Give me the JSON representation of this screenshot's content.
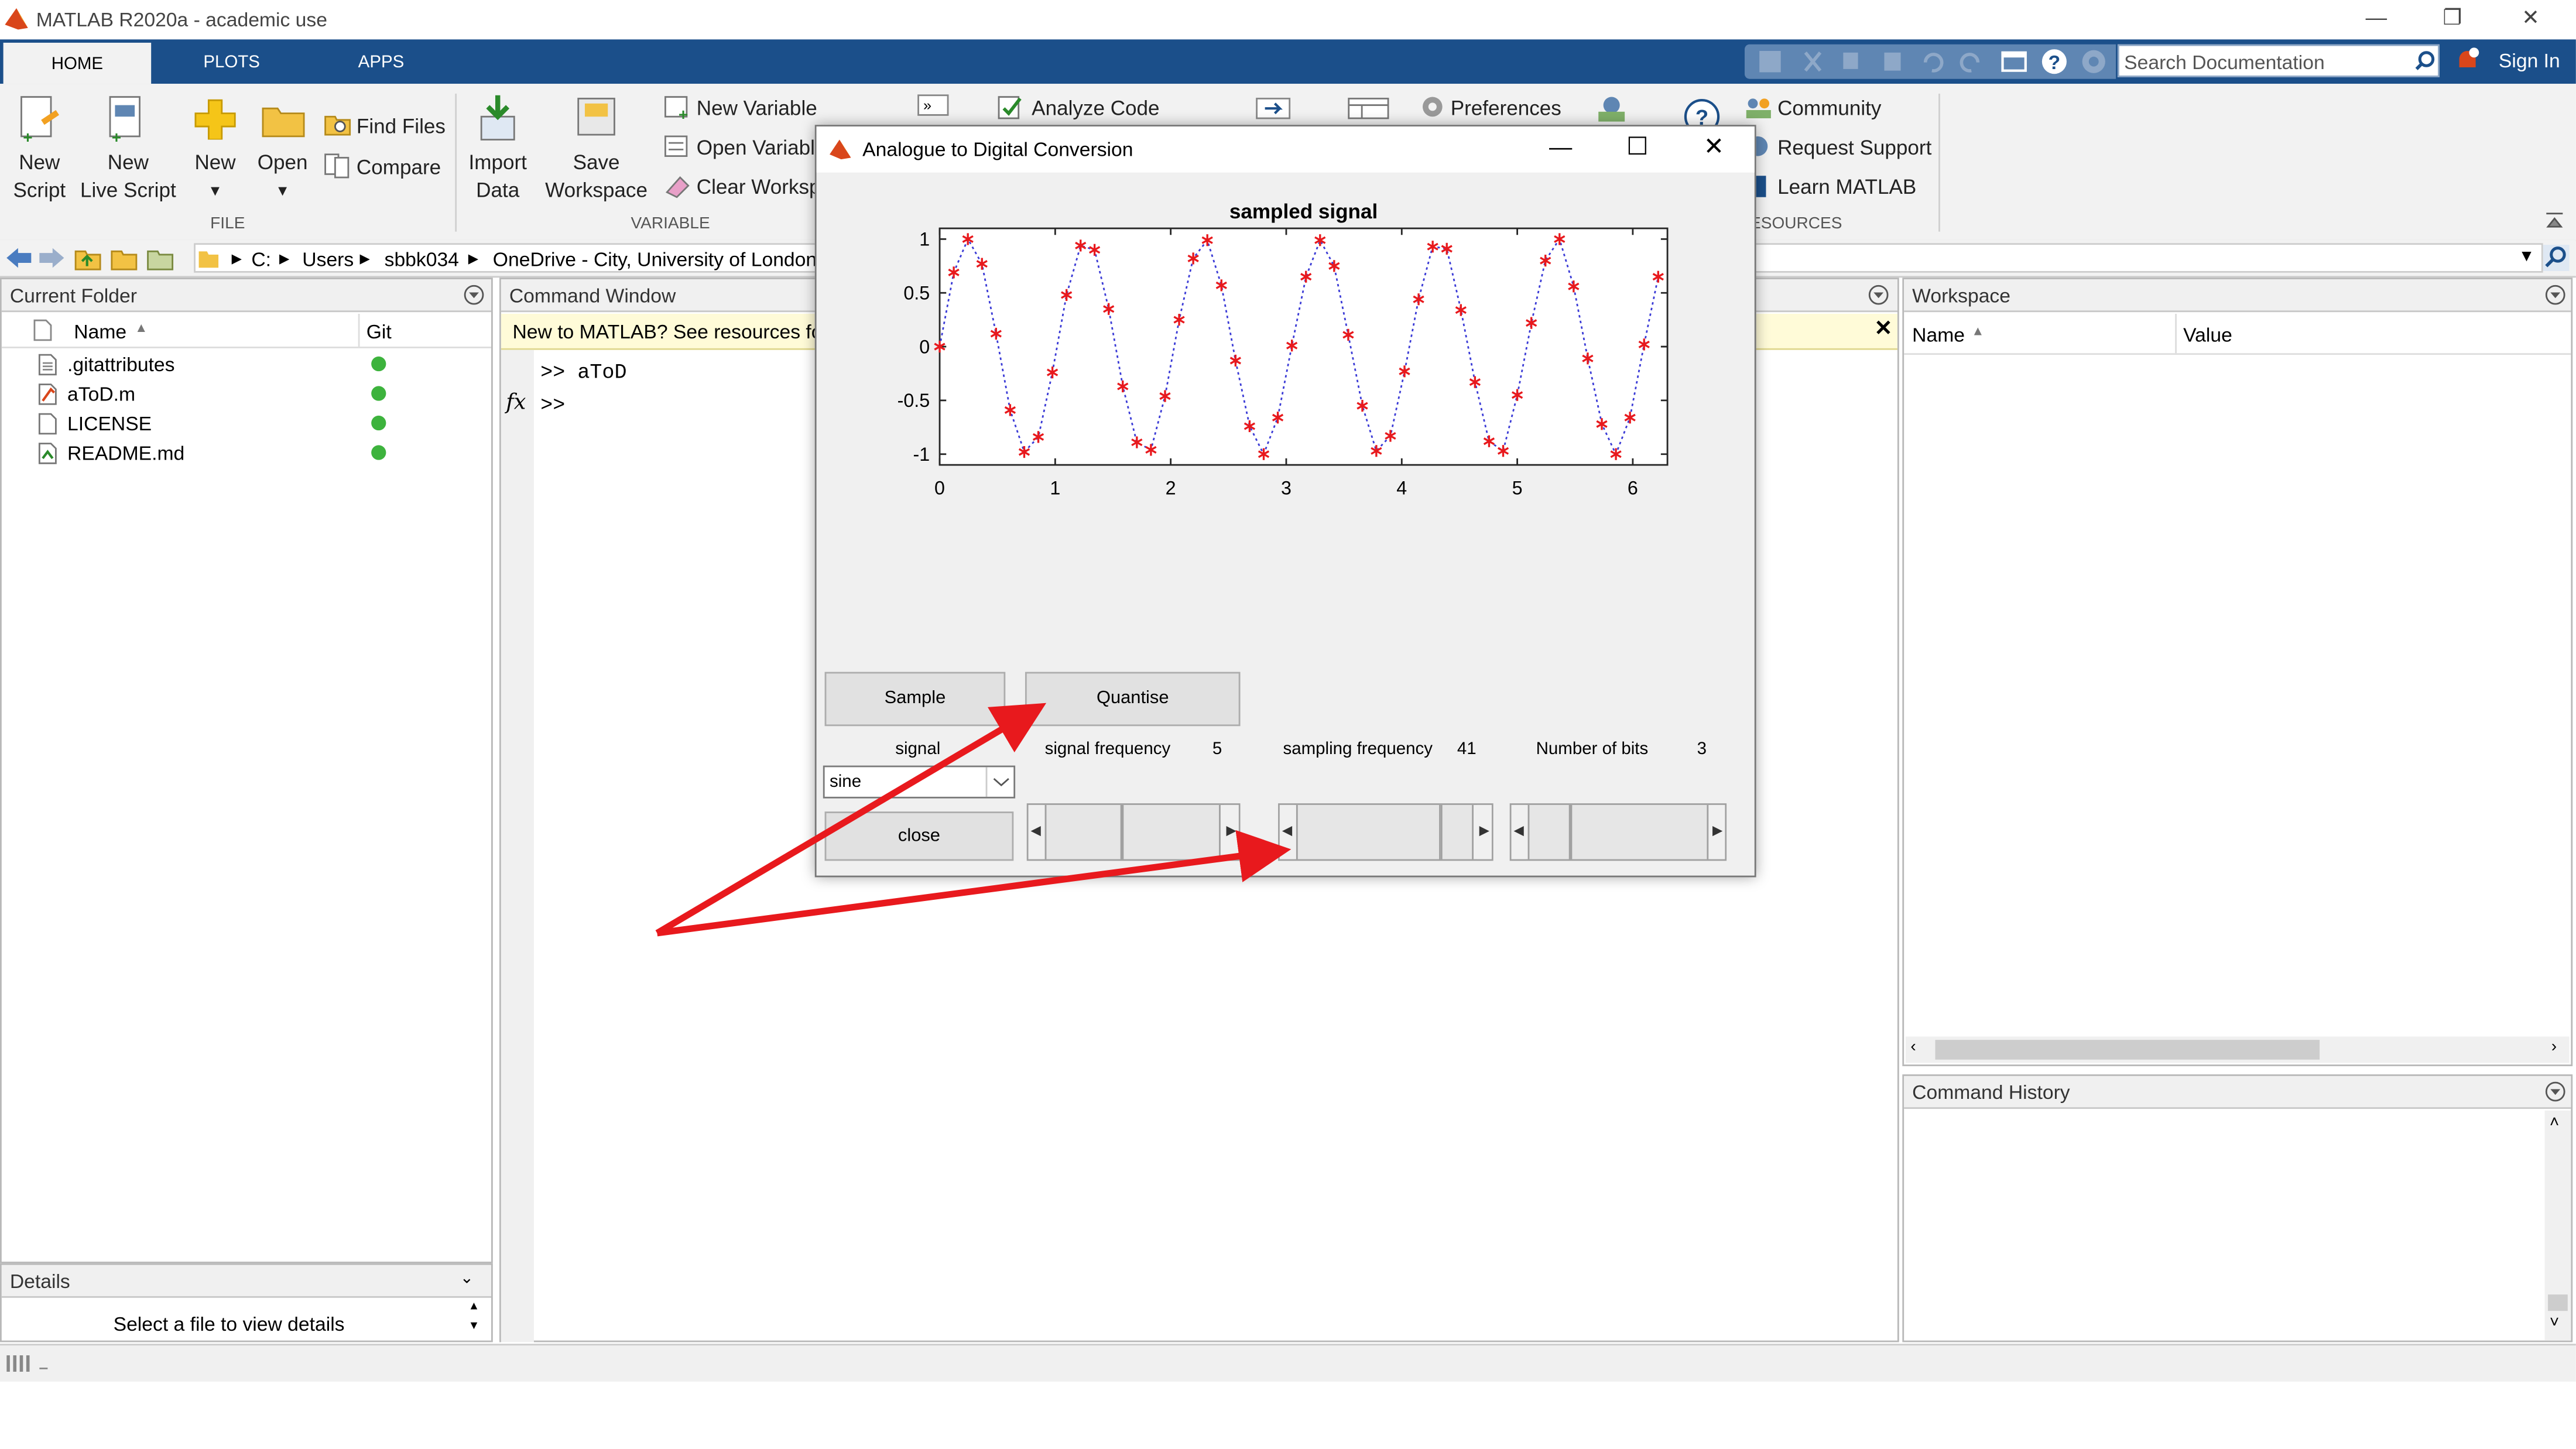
{
  "window": {
    "title": "MATLAB R2020a - academic use"
  },
  "tabs": [
    "HOME",
    "PLOTS",
    "APPS"
  ],
  "search": {
    "placeholder": "Search Documentation"
  },
  "signin_label": "Sign In",
  "ribbon": {
    "file": {
      "new_script": [
        "New",
        "Script"
      ],
      "new_live_script": [
        "New",
        "Live Script"
      ],
      "new": "New",
      "open": "Open",
      "find_files": "Find Files",
      "compare": "Compare",
      "section": "FILE"
    },
    "variable": {
      "import_data": [
        "Import",
        "Data"
      ],
      "save_workspace": [
        "Save",
        "Workspace"
      ],
      "new_variable": "New Variable",
      "open_variable": "Open Variabl",
      "clear_workspace": "Clear Worksp",
      "section": "VARIABLE"
    },
    "code": {
      "analyze_code": "Analyze Code"
    },
    "environment": {
      "preferences": "Preferences"
    },
    "resources": {
      "community": "Community",
      "request_support": "Request Support",
      "learn_matlab": "Learn MATLAB",
      "section": "RESOURCES"
    }
  },
  "address": {
    "crumbs": [
      "C:",
      "Users",
      "sbbk034",
      "OneDrive - City, University of London"
    ]
  },
  "current_folder": {
    "title": "Current Folder",
    "col_name": "Name",
    "col_git": "Git",
    "files": [
      {
        "name": ".gitattributes",
        "icon": "text-file-icon"
      },
      {
        "name": "aToD.m",
        "icon": "matlab-script-icon"
      },
      {
        "name": "LICENSE",
        "icon": "blank-file-icon"
      },
      {
        "name": "README.md",
        "icon": "markdown-file-icon"
      }
    ]
  },
  "details": {
    "title": "Details",
    "message": "Select a file to view details"
  },
  "command_window": {
    "title": "Command Window",
    "notice": "New to MATLAB? See resources fo",
    "lines": [
      ">> aToD",
      ">>"
    ]
  },
  "workspace": {
    "title": "Workspace",
    "col_name": "Name",
    "col_value": "Value"
  },
  "command_history": {
    "title": "Command History"
  },
  "dialog": {
    "title": "Analogue to Digital Conversion",
    "buttons": {
      "sample": "Sample",
      "quantise": "Quantise",
      "close": "close"
    },
    "labels": {
      "signal": "signal",
      "signal_frequency": "signal frequency",
      "signal_frequency_value": "5",
      "sampling_frequency": "sampling frequency",
      "sampling_frequency_value": "41",
      "number_of_bits": "Number of bits",
      "number_of_bits_value": "3"
    },
    "signal_select": {
      "value": "sine"
    }
  },
  "colors": {
    "accent": "#1b4f8a",
    "marker": "#e8191d",
    "arrow": "#e8191d",
    "git_ok": "#3db33d"
  },
  "chart_data": {
    "type": "scatter",
    "title": "sampled signal",
    "xlim": [
      0,
      6.3
    ],
    "ylim": [
      -1.1,
      1.1
    ],
    "x_ticks": [
      0,
      1,
      2,
      3,
      4,
      5,
      6
    ],
    "y_ticks": [
      1,
      0.5,
      0,
      -0.5,
      -1
    ],
    "y_tick_labels": [
      "1",
      "0.5",
      "0",
      "-0.5",
      "-1"
    ],
    "grid": false,
    "series": [
      {
        "style": "dotted-line-with-star-markers",
        "frequency": 5,
        "sampling_frequency": 41,
        "x": [
          0,
          0.122,
          0.244,
          0.366,
          0.488,
          0.61,
          0.732,
          0.854,
          0.976,
          1.098,
          1.22,
          1.341,
          1.463,
          1.585,
          1.707,
          1.829,
          1.951,
          2.073,
          2.195,
          2.317,
          2.439,
          2.561,
          2.683,
          2.805,
          2.927,
          3.049,
          3.171,
          3.293,
          3.415,
          3.537,
          3.659,
          3.78,
          3.902,
          4.024,
          4.146,
          4.268,
          4.39,
          4.512,
          4.634,
          4.756,
          4.878,
          5.0,
          5.122,
          5.244,
          5.366,
          5.488,
          5.61,
          5.732,
          5.854,
          5.976,
          6.098,
          6.22
        ],
        "y": [
          0,
          0.69,
          1.0,
          0.77,
          0.12,
          -0.59,
          -0.98,
          -0.84,
          -0.24,
          0.48,
          0.94,
          0.9,
          0.35,
          -0.37,
          -0.89,
          -0.96,
          -0.46,
          0.25,
          0.82,
          0.99,
          0.57,
          -0.13,
          -0.74,
          -1.0,
          -0.66,
          0.01,
          0.65,
          0.99,
          0.75,
          0.11,
          -0.55,
          -0.97,
          -0.83,
          -0.23,
          0.44,
          0.93,
          0.91,
          0.34,
          -0.33,
          -0.88,
          -0.97,
          -0.45,
          0.22,
          0.8,
          1.0,
          0.56,
          -0.11,
          -0.72,
          -1.0,
          -0.66,
          0.02,
          0.65
        ]
      }
    ]
  }
}
